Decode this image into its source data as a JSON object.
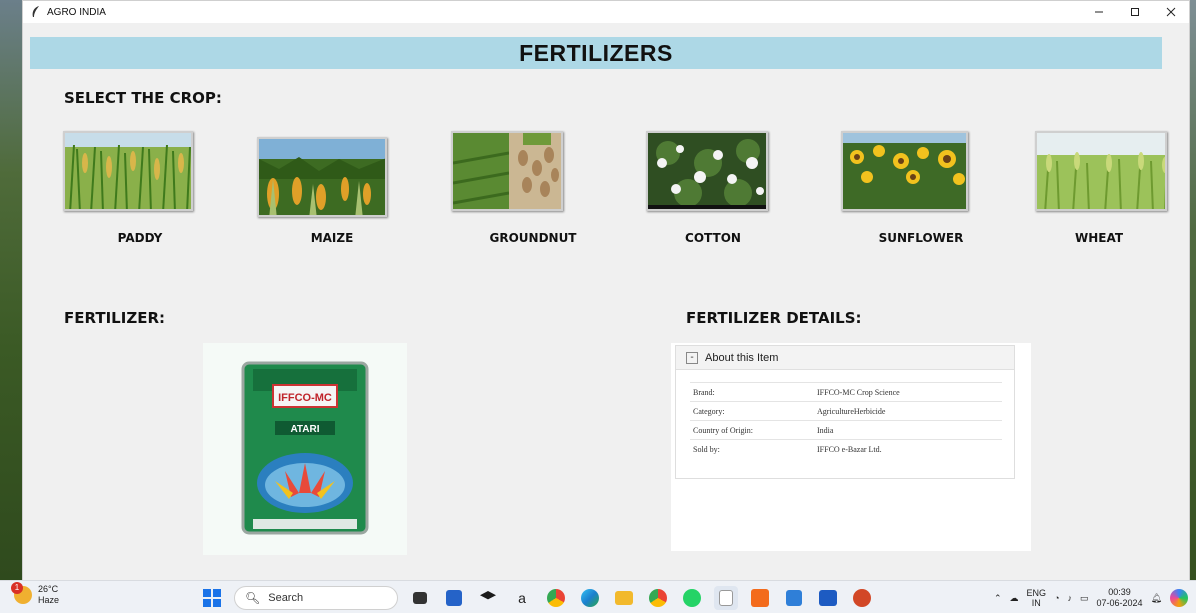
{
  "window": {
    "title": "AGRO INDIA"
  },
  "header": {
    "title": "FERTILIZERS"
  },
  "crop_section": {
    "label": "SELECT THE CROP:",
    "crops": [
      {
        "label": "PADDY"
      },
      {
        "label": "MAIZE"
      },
      {
        "label": "GROUNDNUT"
      },
      {
        "label": "COTTON"
      },
      {
        "label": "SUNFLOWER"
      },
      {
        "label": "WHEAT"
      }
    ]
  },
  "fertilizer_section": {
    "label": "FERTILIZER:",
    "package_brand": "IFFCO-MC",
    "package_product": "ATARI"
  },
  "details_section": {
    "label": "FERTILIZER DETAILS:",
    "panel_title": "About this Item",
    "toggle": "-",
    "rows": [
      {
        "key": "Brand:",
        "value": "IFFCO-MC Crop Science"
      },
      {
        "key": "Category:",
        "value": "AgricultureHerbicide"
      },
      {
        "key": "Country of Origin:",
        "value": "India"
      },
      {
        "key": "Sold by:",
        "value": "IFFCO e-Bazar Ltd."
      }
    ]
  },
  "taskbar": {
    "weather_temp": "26°C",
    "weather_desc": "Haze",
    "weather_badge": "1",
    "search_placeholder": "Search",
    "lang_top": "ENG",
    "lang_bottom": "IN",
    "time": "00:39",
    "date": "07-06-2024"
  }
}
